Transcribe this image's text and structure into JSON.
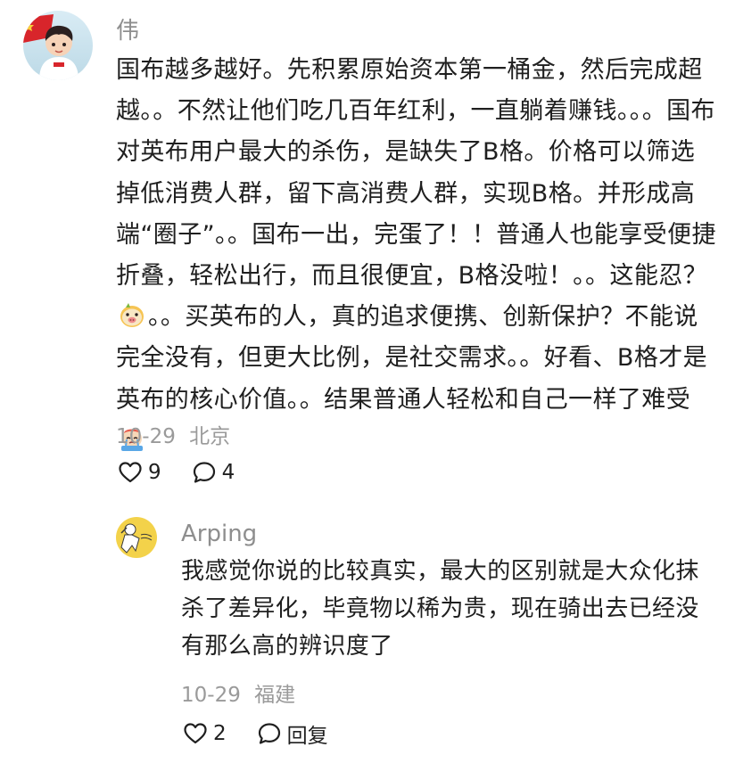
{
  "main_comment": {
    "username": "伟",
    "body_part1": "国布越多越好。先积累原始资本第一桶金，然后完成超越。。不然让他们吃几百年红利，一直躺着赚钱。。。国布对英布用户最大的杀伤，是缺失了B格。价格可以筛选掉低消费人群，留下高消费人群，实现B格。并形成高端“圈子”。。国布一出，完蛋了！！普通人也能享受便捷折叠，轻松出行，而且很便宜，B格没啦！。。这能忍？",
    "body_part2": "。。买英布的人，真的追求便携、创新保护？不能说完全没有，但更大比例，是社交需求。。好看、B格才是英布的核心价值。。结果普通人轻松和自己一样了难受",
    "emoji_1": "pig-face-emoji",
    "emoji_2": "crying-face-emoji",
    "date": "10-29",
    "location": "北京",
    "like_count": "9",
    "reply_count": "4",
    "like_icon": "heart-outline-icon",
    "comment_icon": "speech-bubble-icon"
  },
  "reply_comment": {
    "username": "Arping",
    "body": "我感觉你说的比较真实，最大的区别就是大众化抹杀了差异化，毕竟物以稀为贵，现在骑出去已经没有那么高的辨识度了",
    "date": "10-29",
    "location": "福建",
    "like_count": "2",
    "reply_label": "回复",
    "like_icon": "heart-outline-icon",
    "comment_icon": "speech-bubble-icon"
  },
  "colors": {
    "text_primary": "#1f1f1f",
    "text_secondary": "#8e8e8e",
    "background": "#ffffff",
    "reply_avatar_bg": "#f3d24a"
  }
}
